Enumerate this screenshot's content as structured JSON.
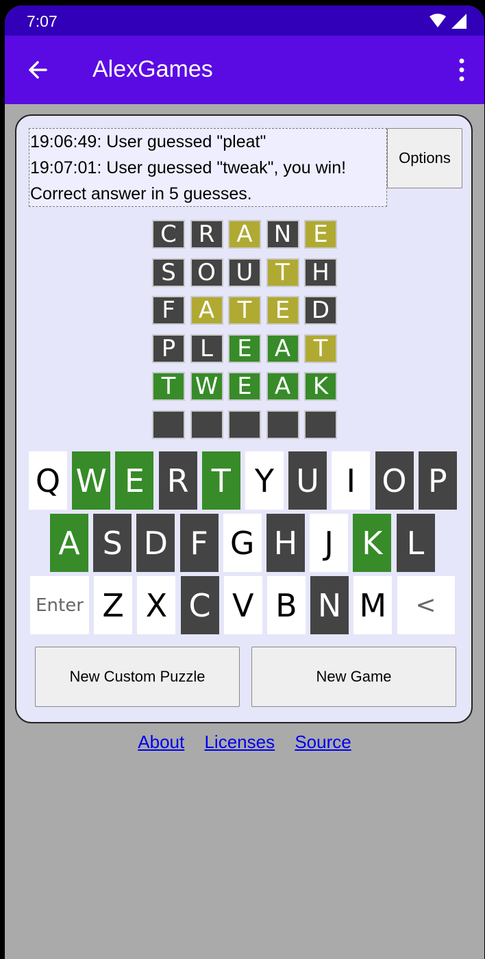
{
  "status_bar": {
    "time": "7:07"
  },
  "app_bar": {
    "title": "AlexGames"
  },
  "log": [
    "19:06:49: User guessed \"pleat\"",
    "19:07:01: User guessed \"tweak\", you win!",
    "Correct answer in 5 guesses."
  ],
  "options_label": "Options",
  "board": [
    {
      "letters": [
        "C",
        "R",
        "A",
        "N",
        "E"
      ],
      "states": [
        "gray",
        "gray",
        "yellow",
        "gray",
        "yellow"
      ]
    },
    {
      "letters": [
        "S",
        "O",
        "U",
        "T",
        "H"
      ],
      "states": [
        "gray",
        "gray",
        "gray",
        "yellow",
        "gray"
      ]
    },
    {
      "letters": [
        "F",
        "A",
        "T",
        "E",
        "D"
      ],
      "states": [
        "gray",
        "yellow",
        "yellow",
        "yellow",
        "gray"
      ]
    },
    {
      "letters": [
        "P",
        "L",
        "E",
        "A",
        "T"
      ],
      "states": [
        "gray",
        "gray",
        "green",
        "green",
        "yellow"
      ]
    },
    {
      "letters": [
        "T",
        "W",
        "E",
        "A",
        "K"
      ],
      "states": [
        "green",
        "green",
        "green",
        "green",
        "green"
      ]
    },
    {
      "letters": [
        "",
        "",
        "",
        "",
        ""
      ],
      "states": [
        "empty",
        "empty",
        "empty",
        "empty",
        "empty"
      ]
    }
  ],
  "keyboard": [
    [
      {
        "label": "Q",
        "state": "white"
      },
      {
        "label": "W",
        "state": "green"
      },
      {
        "label": "E",
        "state": "green"
      },
      {
        "label": "R",
        "state": "gray"
      },
      {
        "label": "T",
        "state": "green"
      },
      {
        "label": "Y",
        "state": "white"
      },
      {
        "label": "U",
        "state": "gray"
      },
      {
        "label": "I",
        "state": "white"
      },
      {
        "label": "O",
        "state": "gray"
      },
      {
        "label": "P",
        "state": "gray"
      }
    ],
    [
      {
        "label": "A",
        "state": "green"
      },
      {
        "label": "S",
        "state": "gray"
      },
      {
        "label": "D",
        "state": "gray"
      },
      {
        "label": "F",
        "state": "gray"
      },
      {
        "label": "G",
        "state": "white"
      },
      {
        "label": "H",
        "state": "gray"
      },
      {
        "label": "J",
        "state": "white"
      },
      {
        "label": "K",
        "state": "green"
      },
      {
        "label": "L",
        "state": "gray"
      }
    ],
    [
      {
        "label": "Enter",
        "state": "white"
      },
      {
        "label": "Z",
        "state": "white"
      },
      {
        "label": "X",
        "state": "white"
      },
      {
        "label": "C",
        "state": "gray"
      },
      {
        "label": "V",
        "state": "white"
      },
      {
        "label": "B",
        "state": "white"
      },
      {
        "label": "N",
        "state": "gray"
      },
      {
        "label": "M",
        "state": "white"
      },
      {
        "label": "<",
        "state": "white"
      }
    ]
  ],
  "buttons": {
    "new_custom_puzzle": "New Custom Puzzle",
    "new_game": "New Game"
  },
  "links": {
    "about": "About",
    "licenses": "Licenses",
    "source": "Source"
  },
  "colors": {
    "status_bar": "#3200b8",
    "app_bar": "#5a0be3",
    "card_bg": "#e6e6fa",
    "tile_gray": "#444444",
    "tile_yellow": "#b0aa32",
    "tile_green": "#378b29",
    "page_bg": "#aaaaaa",
    "link": "#0000ee"
  },
  "icons": {
    "back": "arrow-left-icon",
    "menu": "more-vert-icon",
    "wifi": "wifi-icon",
    "signal": "signal-icon"
  }
}
